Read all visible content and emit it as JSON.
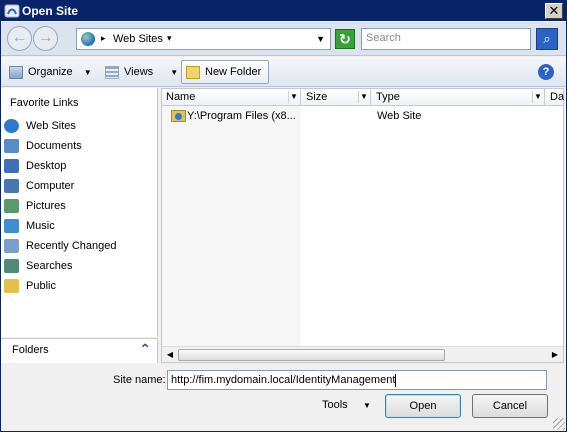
{
  "window": {
    "title": "Open Site"
  },
  "navbar": {
    "back_glyph": "←",
    "forward_glyph": "→",
    "address": {
      "location": "Web Sites",
      "sep_glyph": "▸",
      "arrow_glyph": "▾",
      "dropdown_glyph": "▼"
    },
    "refresh_glyph": "↻",
    "search": {
      "placeholder": "Search",
      "icon_glyph": "⌕"
    }
  },
  "toolbar": {
    "organize": "Organize",
    "views": "Views",
    "new_folder": "New Folder",
    "dropdown_glyph": "▼",
    "help_glyph": "?"
  },
  "sidebar": {
    "title": "Favorite Links",
    "items": [
      {
        "label": "Web Sites",
        "icon": "globe-icon",
        "color": "#2c7bd1"
      },
      {
        "label": "Documents",
        "icon": "documents-icon",
        "color": "#5b8ac8"
      },
      {
        "label": "Desktop",
        "icon": "desktop-icon",
        "color": "#3f6fb5"
      },
      {
        "label": "Computer",
        "icon": "computer-icon",
        "color": "#4a76b0"
      },
      {
        "label": "Pictures",
        "icon": "pictures-icon",
        "color": "#5a9a6a"
      },
      {
        "label": "Music",
        "icon": "music-icon",
        "color": "#3c8fd0"
      },
      {
        "label": "Recently Changed",
        "icon": "recent-icon",
        "color": "#7aa0c8"
      },
      {
        "label": "Searches",
        "icon": "searches-icon",
        "color": "#4f8a7a"
      },
      {
        "label": "Public",
        "icon": "public-folder-icon",
        "color": "#e3c04a"
      }
    ],
    "folders_label": "Folders",
    "folders_chevron": "⌃"
  },
  "filelist": {
    "columns": {
      "name": "Name",
      "size": "Size",
      "type": "Type",
      "date": "Da",
      "dd_glyph": "▼"
    },
    "rows": [
      {
        "name": "Y:\\Program Files (x8...",
        "size": "",
        "type": "Web Site"
      }
    ],
    "scroll_left": "◀",
    "scroll_right": "▶"
  },
  "footer": {
    "site_name_label": "Site name:",
    "site_name_value": "http://fim.mydomain.local/IdentityManagement",
    "tools_label": "Tools",
    "tools_arrow": "▼",
    "open_label": "Open",
    "cancel_label": "Cancel"
  }
}
